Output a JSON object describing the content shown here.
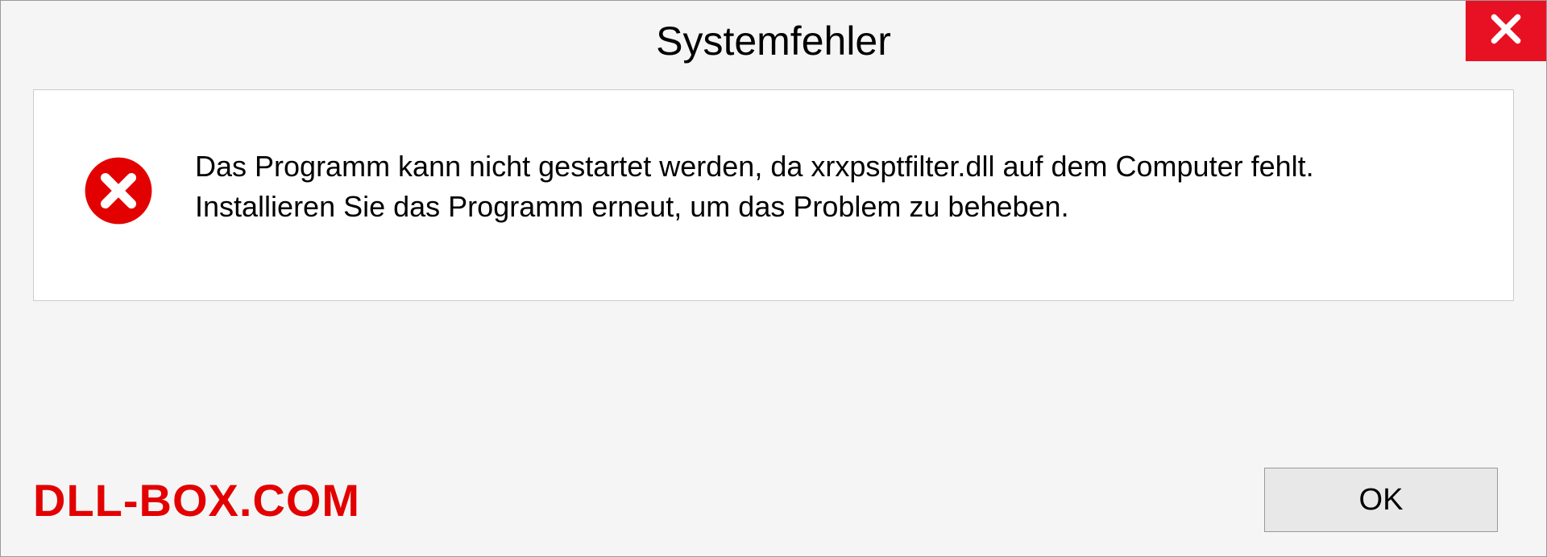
{
  "dialog": {
    "title": "Systemfehler",
    "message": "Das Programm kann nicht gestartet werden, da xrxpsptfilter.dll auf dem Computer fehlt. Installieren Sie das Programm erneut, um das Problem zu beheben.",
    "ok_label": "OK"
  },
  "watermark": "DLL-BOX.COM",
  "colors": {
    "close_bg": "#e81123",
    "error_icon": "#e30000",
    "watermark": "#e30000"
  }
}
